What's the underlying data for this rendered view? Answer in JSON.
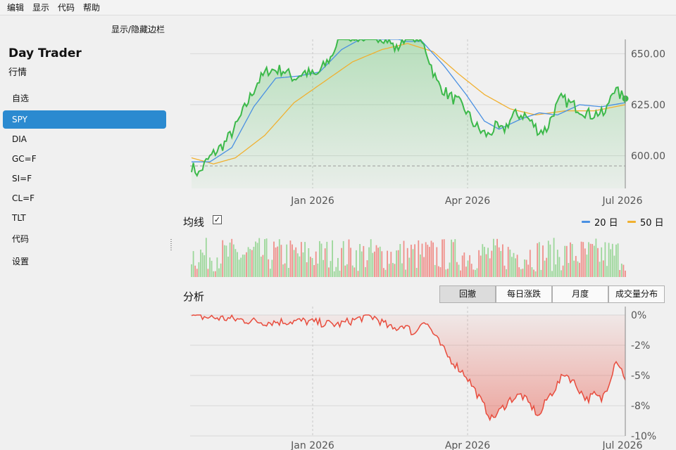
{
  "menubar": {
    "items": [
      "编辑",
      "显示",
      "代码",
      "帮助"
    ]
  },
  "sidebar": {
    "toggle_label": "显示/隐藏边栏",
    "title": "Day Trader",
    "subtitle": "行情",
    "items": [
      "自选",
      "SPY",
      "DIA",
      "GC=F",
      "SI=F",
      "CL=F",
      "TLT",
      "代码",
      "设置"
    ],
    "active_index": 1
  },
  "colors": {
    "price": "#3cb94a",
    "ma20": "#4a90e2",
    "ma50": "#f0b030",
    "drawdown": "#e84c3d",
    "volume_up": "#9cd79a",
    "volume_down": "#ef8f8a",
    "sidebar_active": "#2b8ad0"
  },
  "ma_section": {
    "title": "均线",
    "checked": true,
    "check_glyph": "✓",
    "legend": [
      {
        "label": "20 日",
        "color": "#4a90e2"
      },
      {
        "label": "50 日",
        "color": "#f0b030"
      }
    ]
  },
  "analysis_section": {
    "title": "分析",
    "tabs": [
      "回撤",
      "每日涨跌",
      "月度",
      "成交量分布"
    ],
    "active_tab": 0
  },
  "chart_data": [
    {
      "type": "line",
      "name": "price-chart",
      "x_ticks": [
        "Jan 2026",
        "Apr 2026",
        "Jul 2026"
      ],
      "y_ticks": [
        "600.00",
        "625.00",
        "650.00"
      ],
      "ylim": [
        584,
        657
      ],
      "baseline": 595,
      "grid": true,
      "price_anchors": [
        [
          0,
          595
        ],
        [
          4,
          591
        ],
        [
          8,
          597
        ],
        [
          12,
          601
        ],
        [
          18,
          606
        ],
        [
          24,
          614
        ],
        [
          30,
          625
        ],
        [
          36,
          636
        ],
        [
          42,
          642
        ],
        [
          50,
          642
        ],
        [
          56,
          638
        ],
        [
          62,
          641
        ],
        [
          68,
          639
        ],
        [
          76,
          648
        ],
        [
          82,
          660
        ],
        [
          90,
          658
        ],
        [
          98,
          659
        ],
        [
          106,
          658
        ],
        [
          112,
          652
        ],
        [
          118,
          660
        ],
        [
          124,
          658
        ],
        [
          128,
          652
        ],
        [
          134,
          636
        ],
        [
          140,
          630
        ],
        [
          146,
          626
        ],
        [
          150,
          622
        ],
        [
          154,
          616
        ],
        [
          158,
          612
        ],
        [
          162,
          610
        ],
        [
          166,
          614
        ],
        [
          170,
          612
        ],
        [
          176,
          620
        ],
        [
          182,
          620
        ],
        [
          186,
          616
        ],
        [
          190,
          612
        ],
        [
          194,
          613
        ],
        [
          198,
          622
        ],
        [
          202,
          628
        ],
        [
          206,
          626
        ],
        [
          210,
          624
        ],
        [
          214,
          622
        ],
        [
          218,
          620
        ],
        [
          222,
          621
        ],
        [
          226,
          620
        ],
        [
          230,
          633
        ],
        [
          234,
          630
        ],
        [
          237,
          628
        ]
      ],
      "ma20_anchors": [
        [
          0,
          597
        ],
        [
          10,
          597
        ],
        [
          22,
          604
        ],
        [
          34,
          624
        ],
        [
          46,
          638
        ],
        [
          58,
          639
        ],
        [
          70,
          641
        ],
        [
          82,
          652
        ],
        [
          94,
          658
        ],
        [
          106,
          660
        ],
        [
          116,
          656
        ],
        [
          126,
          656
        ],
        [
          138,
          644
        ],
        [
          150,
          630
        ],
        [
          160,
          617
        ],
        [
          168,
          613
        ],
        [
          180,
          618
        ],
        [
          190,
          621
        ],
        [
          200,
          620
        ],
        [
          212,
          625
        ],
        [
          224,
          624
        ],
        [
          237,
          626
        ]
      ],
      "ma50_anchors": [
        [
          0,
          599
        ],
        [
          12,
          596
        ],
        [
          24,
          599
        ],
        [
          40,
          610
        ],
        [
          56,
          626
        ],
        [
          72,
          636
        ],
        [
          88,
          646
        ],
        [
          104,
          652
        ],
        [
          118,
          655
        ],
        [
          132,
          651
        ],
        [
          146,
          640
        ],
        [
          160,
          630
        ],
        [
          174,
          623
        ],
        [
          188,
          620
        ],
        [
          204,
          622
        ],
        [
          220,
          622
        ],
        [
          237,
          625
        ]
      ],
      "last_point": 628
    },
    {
      "type": "bar",
      "name": "volume-chart",
      "bars": 237,
      "series": "daily volume (relative)"
    },
    {
      "type": "area",
      "name": "drawdown-chart",
      "x_ticks": [
        "Jan 2026",
        "Apr 2026",
        "Jul 2026"
      ],
      "y_ticks": [
        "0%",
        "-2%",
        "-5%",
        "-8%",
        "-10%"
      ],
      "ylim": [
        -10,
        0
      ],
      "grid": true,
      "drawdown_anchors": [
        [
          0,
          -0.1
        ],
        [
          20,
          -0.3
        ],
        [
          40,
          -0.6
        ],
        [
          60,
          -0.5
        ],
        [
          80,
          -0.8
        ],
        [
          96,
          -0.1
        ],
        [
          100,
          -0.2
        ],
        [
          110,
          -1.2
        ],
        [
          116,
          -0.8
        ],
        [
          122,
          -1.6
        ],
        [
          126,
          -0.4
        ],
        [
          130,
          -1.0
        ],
        [
          134,
          -2.0
        ],
        [
          140,
          -3.4
        ],
        [
          146,
          -4.4
        ],
        [
          150,
          -5.0
        ],
        [
          154,
          -6.0
        ],
        [
          160,
          -7.6
        ],
        [
          164,
          -8.6
        ],
        [
          168,
          -8.0
        ],
        [
          174,
          -7.0
        ],
        [
          180,
          -6.6
        ],
        [
          186,
          -7.6
        ],
        [
          190,
          -8.4
        ],
        [
          194,
          -7.0
        ],
        [
          198,
          -6.2
        ],
        [
          204,
          -4.8
        ],
        [
          208,
          -5.4
        ],
        [
          212,
          -6.2
        ],
        [
          216,
          -7.0
        ],
        [
          220,
          -6.6
        ],
        [
          224,
          -7.0
        ],
        [
          228,
          -5.6
        ],
        [
          232,
          -3.6
        ],
        [
          237,
          -5.2
        ]
      ]
    }
  ]
}
